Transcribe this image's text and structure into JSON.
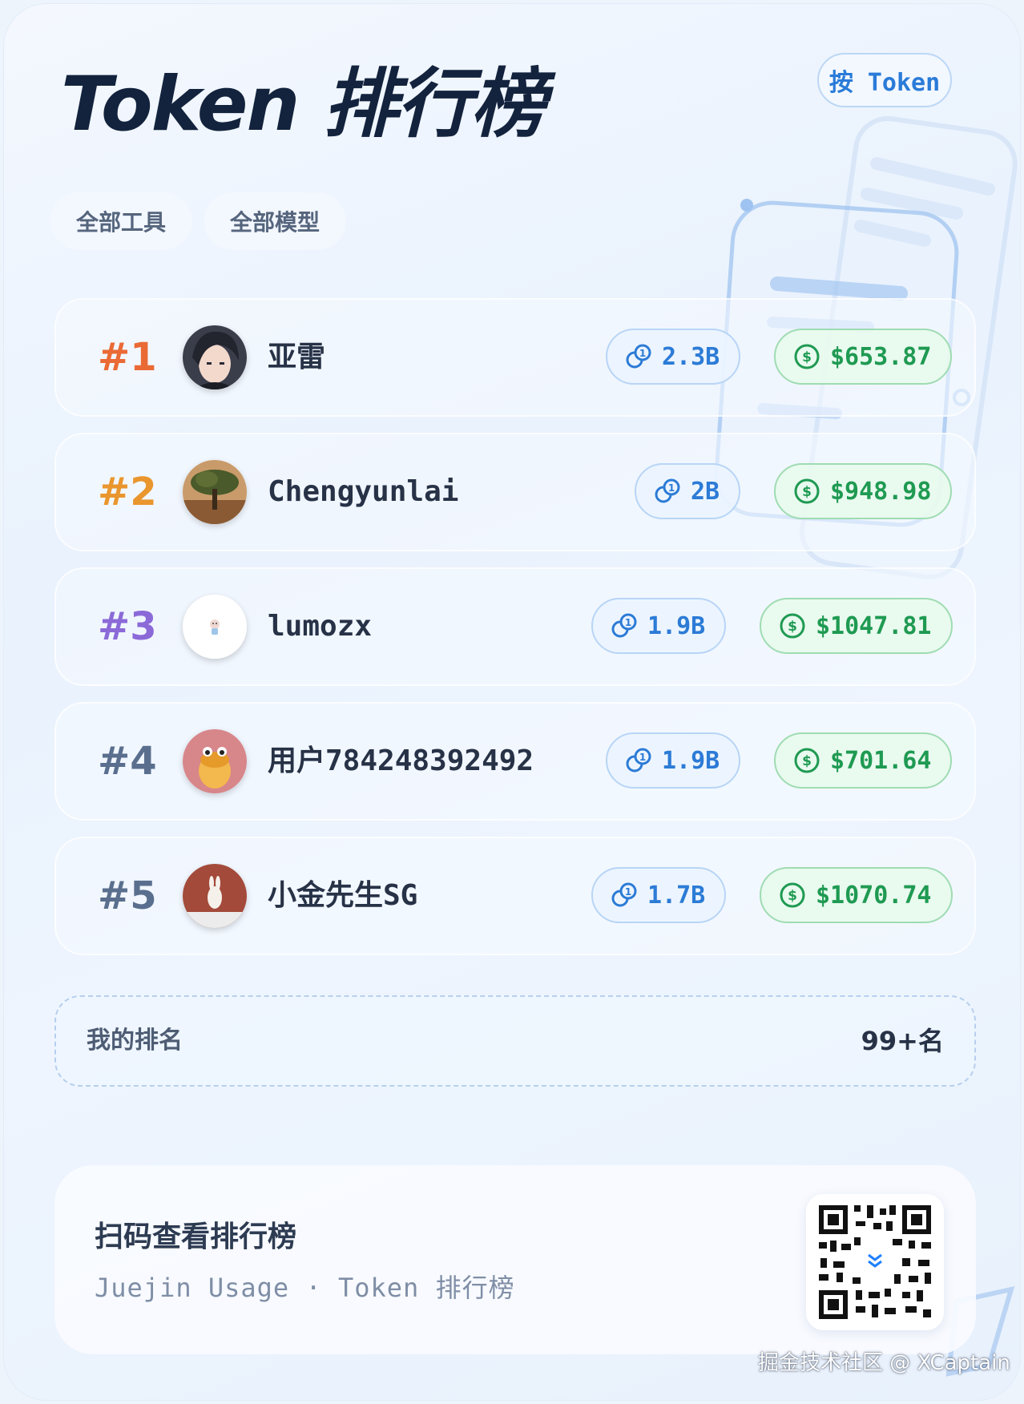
{
  "header": {
    "title": "Token 排行榜",
    "sort_button": "按 Token"
  },
  "filters": [
    {
      "label": "全部工具"
    },
    {
      "label": "全部模型"
    }
  ],
  "leaderboard": [
    {
      "rank": "#1",
      "name": "亚雷",
      "tokens": "2.3B",
      "cost": "$653.87",
      "rank_color": "#ea6a35"
    },
    {
      "rank": "#2",
      "name": "Chengyunlai",
      "tokens": "2B",
      "cost": "$948.98",
      "rank_color": "#e9962e"
    },
    {
      "rank": "#3",
      "name": "lumozx",
      "tokens": "1.9B",
      "cost": "$1047.81",
      "rank_color": "#8b6ad8"
    },
    {
      "rank": "#4",
      "name": "用户784248392492",
      "tokens": "1.9B",
      "cost": "$701.64",
      "rank_color": "#5a6f8e"
    },
    {
      "rank": "#5",
      "name": "小金先生SG",
      "tokens": "1.7B",
      "cost": "$1070.74",
      "rank_color": "#5a6f8e"
    }
  ],
  "my_rank": {
    "label": "我的排名",
    "value": "99+名"
  },
  "footer": {
    "title": "扫码查看排行榜",
    "subtitle": "Juejin Usage · Token 排行榜"
  },
  "watermark": "掘金技术社区 @ XCaptain",
  "colors": {
    "accent_blue": "#2c7bd6",
    "accent_green": "#1f9a52",
    "title": "#13233d"
  },
  "icons": {
    "token": "coins-icon",
    "cost": "dollar-circle-icon"
  }
}
